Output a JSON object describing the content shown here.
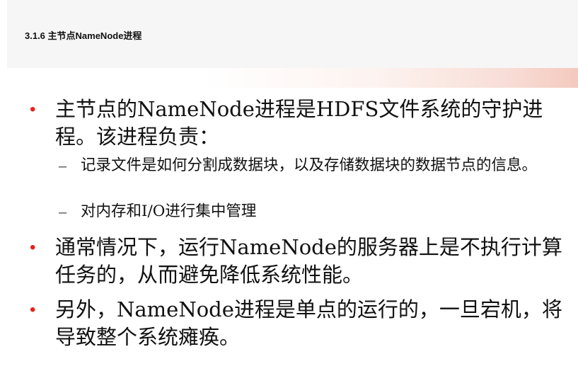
{
  "header": {
    "title": "3.1.6 主节点NameNode进程"
  },
  "bullets": [
    {
      "text": "主节点的NameNode进程是HDFS文件系统的守护进程。该进程负责：",
      "sub": [
        "记录文件是如何分割成数据块，以及存储数据块的数据节点的信息。",
        "对内存和I/O进行集中管理"
      ]
    },
    {
      "text": "通常情况下，运行NameNode的服务器上是不执行计算任务的，从而避免降低系统性能。"
    },
    {
      "text": "另外，NameNode进程是单点的运行的，一旦宕机，将导致整个系统瘫痪。"
    }
  ],
  "symbols": {
    "bullet": "•",
    "dash": "–"
  },
  "colors": {
    "bullet": "#e0241b",
    "header_bg": "#f7f6f6"
  }
}
